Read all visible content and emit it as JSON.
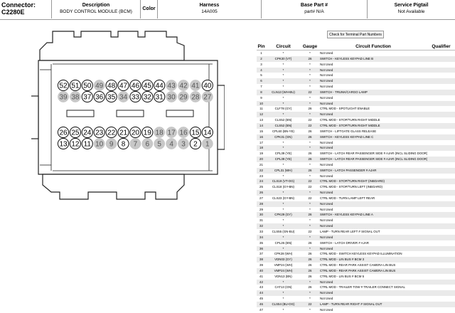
{
  "header": {
    "connector_label": "Connector:",
    "connector_value": "C2280E",
    "description_label": "Description",
    "description_value": "BODY CONTROL MODULE (BCM)",
    "color_label": "Color",
    "harness_label": "Harness",
    "harness_value": "14A005",
    "base_part_label": "Base Part #",
    "base_part_value": "part# N/A",
    "pigtail_label": "Service Pigtail",
    "pigtail_value": "Not Available"
  },
  "terminal_button": "Check for Terminal Part Numbers",
  "diagram": {
    "row_top": [
      52,
      51,
      50,
      49,
      48,
      47,
      46,
      45,
      44,
      43,
      42,
      41,
      40
    ],
    "row_upper": [
      39,
      38,
      37,
      36,
      35,
      34,
      33,
      32,
      31,
      30,
      29,
      28,
      27
    ],
    "row_lower": [
      26,
      25,
      24,
      23,
      22,
      21,
      20,
      19,
      18,
      17,
      16,
      15,
      14
    ],
    "row_bottom": [
      13,
      12,
      11,
      10,
      9,
      8,
      7,
      6,
      5,
      4,
      3,
      2,
      1
    ],
    "populated_pins": [
      52,
      51,
      50,
      48,
      47,
      46,
      45,
      44,
      40,
      37,
      36,
      35,
      33,
      32,
      31,
      26,
      25,
      24,
      23,
      22,
      21,
      20,
      19,
      15,
      14,
      13,
      12,
      11,
      8,
      2
    ]
  },
  "table": {
    "headers": {
      "pin": "Pin",
      "circuit": "Circuit",
      "gauge": "Gauge",
      "function": "Circuit Function",
      "qualifier": "Qualifier"
    },
    "rows": [
      {
        "pin": "1",
        "circuit": "*",
        "gauge": "*",
        "function": "Not Used"
      },
      {
        "pin": "2",
        "circuit": "CPK30 (VT)",
        "gauge": "26",
        "function": "SWITCH - KEYLESS KEYPAD LINE B"
      },
      {
        "pin": "3",
        "circuit": "*",
        "gauge": "*",
        "function": "Not Used"
      },
      {
        "pin": "4",
        "circuit": "*",
        "gauge": "*",
        "function": "Not Used"
      },
      {
        "pin": "5",
        "circuit": "*",
        "gauge": "*",
        "function": "Not Used"
      },
      {
        "pin": "6",
        "circuit": "*",
        "gauge": "*",
        "function": "Not Used"
      },
      {
        "pin": "7",
        "circuit": "*",
        "gauge": "*",
        "function": "Not Used"
      },
      {
        "pin": "8",
        "circuit": "CLN13 (WH-BU)",
        "gauge": "22",
        "function": "SWITCH - TRUNK/CARGO LAMP"
      },
      {
        "pin": "9",
        "circuit": "*",
        "gauge": "*",
        "function": "Not Used"
      },
      {
        "pin": "10",
        "circuit": "*",
        "gauge": "*",
        "function": "Not Used"
      },
      {
        "pin": "11",
        "circuit": "CLF78 (GY)",
        "gauge": "26",
        "function": "CTRL MOD - SPOTLIGHT ENABLE"
      },
      {
        "pin": "12",
        "circuit": "*",
        "gauge": "*",
        "function": "Not Used"
      },
      {
        "pin": "13",
        "circuit": "CLS52 (BN)",
        "gauge": "22",
        "function": "CTRL MOD - STOP/TURN RIGHT MIDDLE"
      },
      {
        "pin": "14",
        "circuit": "CLS52 (BN)",
        "gauge": "22",
        "function": "CTRL MOD - STOP/TURN RIGHT MIDDLE"
      },
      {
        "pin": "15",
        "circuit": "CPL60 (BN-YE)",
        "gauge": "26",
        "function": "SWITCH - LIFTGATE GLASS RELEASE"
      },
      {
        "pin": "16",
        "circuit": "CPK31 (GN)",
        "gauge": "26",
        "function": "SWITCH - KEYLESS KEYPAD LINE C"
      },
      {
        "pin": "17",
        "circuit": "*",
        "gauge": "*",
        "function": "Not Used"
      },
      {
        "pin": "18",
        "circuit": "*",
        "gauge": "*",
        "function": "Not Used"
      },
      {
        "pin": "19",
        "circuit": "CPL39 (YE)",
        "gauge": "26",
        "function": "SWITCH - LATCH REAR PASSENGER SIDE # AJAR (INCL SLIDING DOOR)"
      },
      {
        "pin": "20",
        "circuit": "CPL39 (YE)",
        "gauge": "26",
        "function": "SWITCH - LATCH REAR PASSENGER SIDE # AJAR (INCL SLIDING DOOR)"
      },
      {
        "pin": "21",
        "circuit": "*",
        "gauge": "*",
        "function": "Not Used"
      },
      {
        "pin": "22",
        "circuit": "CPL31 (WH)",
        "gauge": "26",
        "function": "SWITCH - LATCH PASSENGER # AJAR"
      },
      {
        "pin": "23",
        "circuit": "*",
        "gauge": "*",
        "function": "Not Used"
      },
      {
        "pin": "24",
        "circuit": "CLS19 (VT-OG)",
        "gauge": "22",
        "function": "CTRL MOD - STOP/TURN RIGHT (INBOARD)"
      },
      {
        "pin": "25",
        "circuit": "CLS18 (GY-BN)",
        "gauge": "22",
        "function": "CTRL MOD - STOP/TURN LEFT (INBOARD)"
      },
      {
        "pin": "26",
        "circuit": "*",
        "gauge": "*",
        "function": "Not Used"
      },
      {
        "pin": "27",
        "circuit": "CLS23 (GY-BN)",
        "gauge": "22",
        "function": "CTRL MOD - TURN LAMP LEFT REAR"
      },
      {
        "pin": "28",
        "circuit": "*",
        "gauge": "*",
        "function": "Not Used"
      },
      {
        "pin": "29",
        "circuit": "*",
        "gauge": "*",
        "function": "Not Used"
      },
      {
        "pin": "30",
        "circuit": "CPK29 (GY)",
        "gauge": "26",
        "function": "SWITCH - KEYLESS KEYPAD LINE A"
      },
      {
        "pin": "31",
        "circuit": "*",
        "gauge": "*",
        "function": "Not Used"
      },
      {
        "pin": "32",
        "circuit": "*",
        "gauge": "*",
        "function": "Not Used"
      },
      {
        "pin": "33",
        "circuit": "CLS55 (GN-BU)",
        "gauge": "22",
        "function": "LAMP - TURN REAR LEFT # SIGNAL OUT"
      },
      {
        "pin": "34",
        "circuit": "*",
        "gauge": "*",
        "function": "Not Used"
      },
      {
        "pin": "35",
        "circuit": "CPL26 (BN)",
        "gauge": "26",
        "function": "SWITCH - LATCH DRIVER # AJAR"
      },
      {
        "pin": "36",
        "circuit": "*",
        "gauge": "*",
        "function": "Not Used"
      },
      {
        "pin": "37",
        "circuit": "CPK28 (WH)",
        "gauge": "26",
        "function": "CTRL MOD - SWITCH KEYLESS KEYPAD ILLUMINATION"
      },
      {
        "pin": "38",
        "circuit": "VDN03 (GY)",
        "gauge": "26",
        "function": "CTRL MOD - LIN BUS # BCM 3"
      },
      {
        "pin": "39",
        "circuit": "VMP24 (WH)",
        "gauge": "26",
        "function": "CTRL MOD - REAR PARK ASSIST CAMERA LIN BUS"
      },
      {
        "pin": "40",
        "circuit": "VMP24 (WH)",
        "gauge": "26",
        "function": "CTRL MOD - REAR PARK ASSIST CAMERA LIN BUS"
      },
      {
        "pin": "41",
        "circuit": "VDN13 (BN)",
        "gauge": "26",
        "function": "CTRL MOD - LIN BUS # BCM 5"
      },
      {
        "pin": "42",
        "circuit": "*",
        "gauge": "*",
        "function": "Not Used"
      },
      {
        "pin": "43",
        "circuit": "CAT13 (GN)",
        "gauge": "26",
        "function": "CTRL MOD - TRAILER TOW # TRAILER CONNECT SIGNAL"
      },
      {
        "pin": "44",
        "circuit": "*",
        "gauge": "*",
        "function": "Not Used"
      },
      {
        "pin": "45",
        "circuit": "*",
        "gauge": "*",
        "function": "Not Used"
      },
      {
        "pin": "46",
        "circuit": "CLS54 (BU-OG)",
        "gauge": "22",
        "function": "LAMP - TURN REAR RIGHT # SIGNAL OUT"
      },
      {
        "pin": "47",
        "circuit": "*",
        "gauge": "*",
        "function": "Not Used"
      }
    ]
  },
  "colors": {
    "populated": "#ffffff",
    "empty": "#c8c8c8",
    "stroke": "#222222",
    "border": "#999999"
  }
}
